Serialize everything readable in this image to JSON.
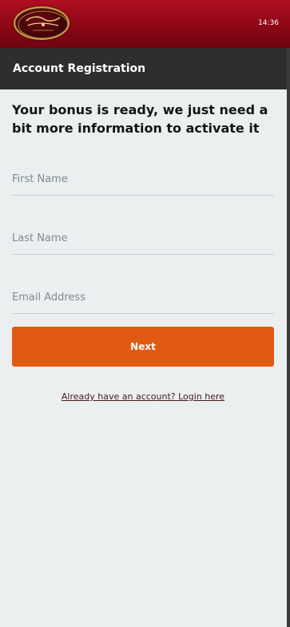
{
  "header": {
    "brand_logo": "villento-casino-logo",
    "time": "14:36"
  },
  "page": {
    "title": "Account Registration",
    "lead": "Your bonus is ready, we just need a bit more information to activate it"
  },
  "form": {
    "first_name_placeholder": "First Name",
    "last_name_placeholder": "Last Name",
    "email_placeholder": "Email Address",
    "next_label": "Next"
  },
  "links": {
    "login": "Already have an account? Login here"
  },
  "colors": {
    "brand_red": "#a00c1d",
    "title_bar": "#2f2e2e",
    "accent_orange": "#e05a12",
    "background": "#eceff0"
  }
}
